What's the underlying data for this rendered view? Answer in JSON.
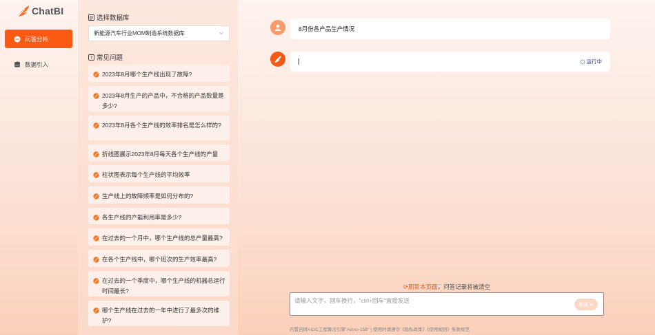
{
  "app": {
    "name": "ChatBI"
  },
  "nav": {
    "items": [
      {
        "label": "问答分析",
        "icon": "chat-icon",
        "active": true
      },
      {
        "label": "数据引入",
        "icon": "database-icon",
        "active": false
      }
    ]
  },
  "panel": {
    "db_title": "选择数据库",
    "db_selected": "新能源汽车行业MOM制造系统数据库",
    "faq_title": "常见问题",
    "faqs": [
      "2023年8月哪个生产线出现了故障?",
      "2023年8月生产的产品中，不合格的产品数量是多少?",
      "2023年8月各个生产线的效率排名是怎么样的?",
      "折线图展示2023年8月每天各个生产线的产量",
      "柱状图表示每个生产线的平均效率",
      "生产线上的故障频率是如何分布的?",
      "各生产线的产能利用率是多少?",
      "在过去的一个月中，哪个生产线的总产量最高?",
      "在各个生产线中，哪个班次的生产效率最高?",
      "在过去的一个季度中，哪个生产线的机器总运行时间最长?",
      "哪个生产线在过去的一年中进行了最多次的维护?"
    ]
  },
  "chat": {
    "user_message": "8月份各产品生产情况",
    "status": "运行中",
    "refresh_link": "刷新本页面",
    "refresh_note": "，问答记录将被清空",
    "input_placeholder": "请输入文字，回车换行，\"ctrl+回车\"直接发送",
    "send_label": "发送",
    "footer": "内置自研AIGC工程算法引擎\"Ainno-15B\"   |   使用时请遵守《隐私政策》《使用规则》条款规范"
  },
  "colors": {
    "accent": "#fa5a14",
    "send_disabled": "#fcd8c8"
  }
}
